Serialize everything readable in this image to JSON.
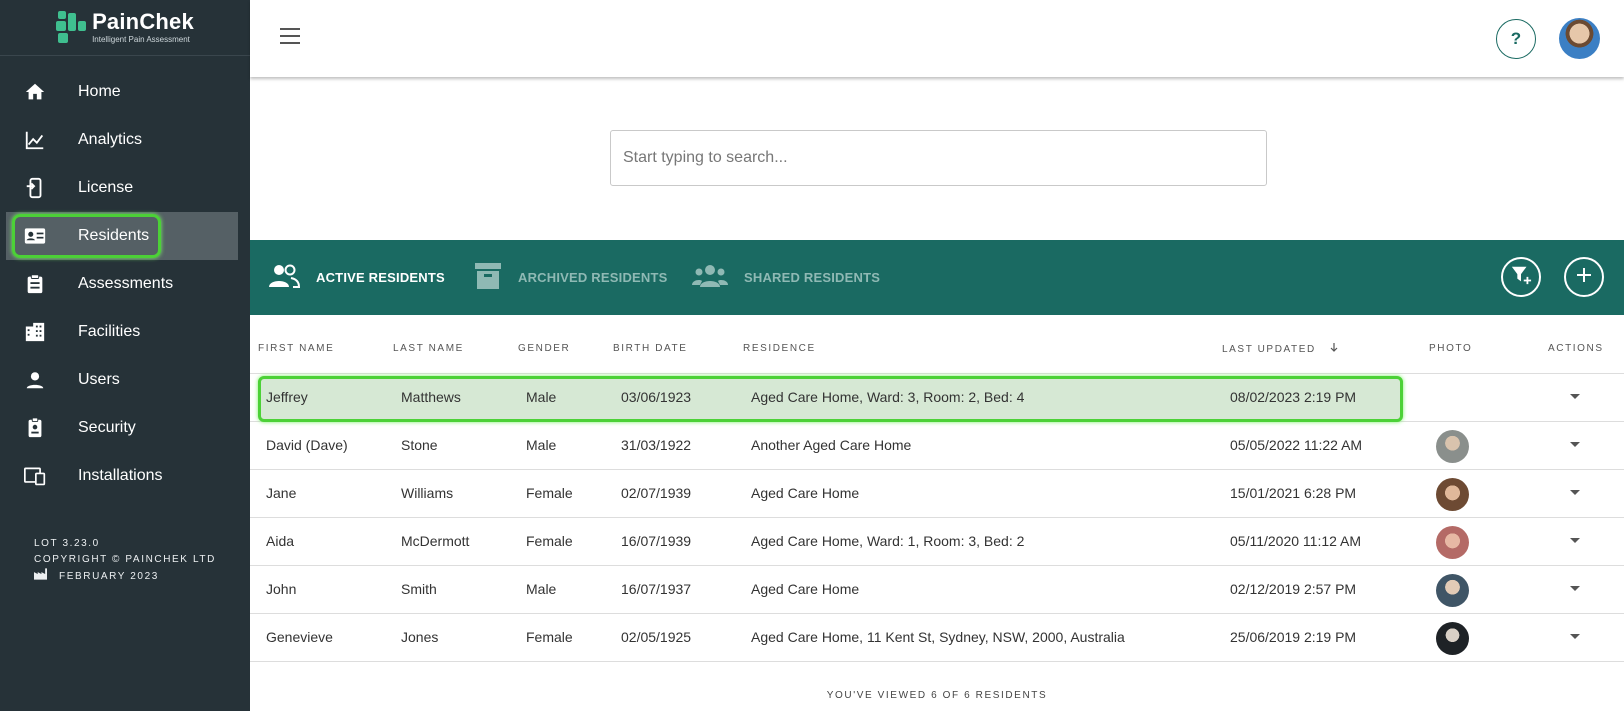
{
  "brand": {
    "name": "PainChek",
    "tagline": "Intelligent Pain Assessment",
    "accent": "#1a6a62",
    "sidebar_bg": "#263238"
  },
  "sidebar": {
    "items": [
      {
        "label": "Home",
        "icon": "home-icon"
      },
      {
        "label": "Analytics",
        "icon": "chart-icon"
      },
      {
        "label": "License",
        "icon": "license-icon"
      },
      {
        "label": "Residents",
        "icon": "id-card-icon",
        "active": true
      },
      {
        "label": "Assessments",
        "icon": "clipboard-icon"
      },
      {
        "label": "Facilities",
        "icon": "building-icon"
      },
      {
        "label": "Users",
        "icon": "person-icon"
      },
      {
        "label": "Security",
        "icon": "badge-icon"
      },
      {
        "label": "Installations",
        "icon": "devices-icon"
      }
    ],
    "footer": {
      "lot": "LOT 3.23.0",
      "copyright": "COPYRIGHT © PAINCHEK LTD",
      "date": "FEBRUARY 2023"
    }
  },
  "topbar": {
    "help_label": "?"
  },
  "search": {
    "placeholder": "Start typing to search..."
  },
  "tabs": [
    {
      "label": "ACTIVE RESIDENTS",
      "active": true
    },
    {
      "label": "ARCHIVED RESIDENTS",
      "active": false
    },
    {
      "label": "SHARED RESIDENTS",
      "active": false
    }
  ],
  "table": {
    "headers": [
      "FIRST NAME",
      "LAST NAME",
      "GENDER",
      "BIRTH DATE",
      "RESIDENCE",
      "LAST UPDATED",
      "PHOTO",
      "ACTIONS"
    ],
    "rows": [
      {
        "first": "Jeffrey",
        "last": "Matthews",
        "gender": "Male",
        "birth": "03/06/1923",
        "residence": "Aged Care Home, Ward: 3, Room: 2, Bed: 4",
        "updated": "08/02/2023 2:19 PM",
        "photo": false,
        "highlight": true
      },
      {
        "first": "David (Dave)",
        "last": "Stone",
        "gender": "Male",
        "birth": "31/03/1922",
        "residence": "Another Aged Care Home",
        "updated": "05/05/2022 11:22 AM",
        "photo": true
      },
      {
        "first": "Jane",
        "last": "Williams",
        "gender": "Female",
        "birth": "02/07/1939",
        "residence": "Aged Care Home",
        "updated": "15/01/2021 6:28 PM",
        "photo": true
      },
      {
        "first": "Aida",
        "last": "McDermott",
        "gender": "Female",
        "birth": "16/07/1939",
        "residence": "Aged Care Home, Ward: 1, Room: 3, Bed: 2",
        "updated": "05/11/2020 11:12 AM",
        "photo": true
      },
      {
        "first": "John",
        "last": "Smith",
        "gender": "Male",
        "birth": "16/07/1937",
        "residence": "Aged Care Home",
        "updated": "02/12/2019 2:57 PM",
        "photo": true
      },
      {
        "first": "Genevieve",
        "last": "Jones",
        "gender": "Female",
        "birth": "02/05/1925",
        "residence": "Aged Care Home, 11 Kent St, Sydney, NSW, 2000, Australia",
        "updated": "25/06/2019 2:19 PM",
        "photo": true
      }
    ],
    "summary": "YOU'VE VIEWED 6 OF 6 RESIDENTS"
  }
}
